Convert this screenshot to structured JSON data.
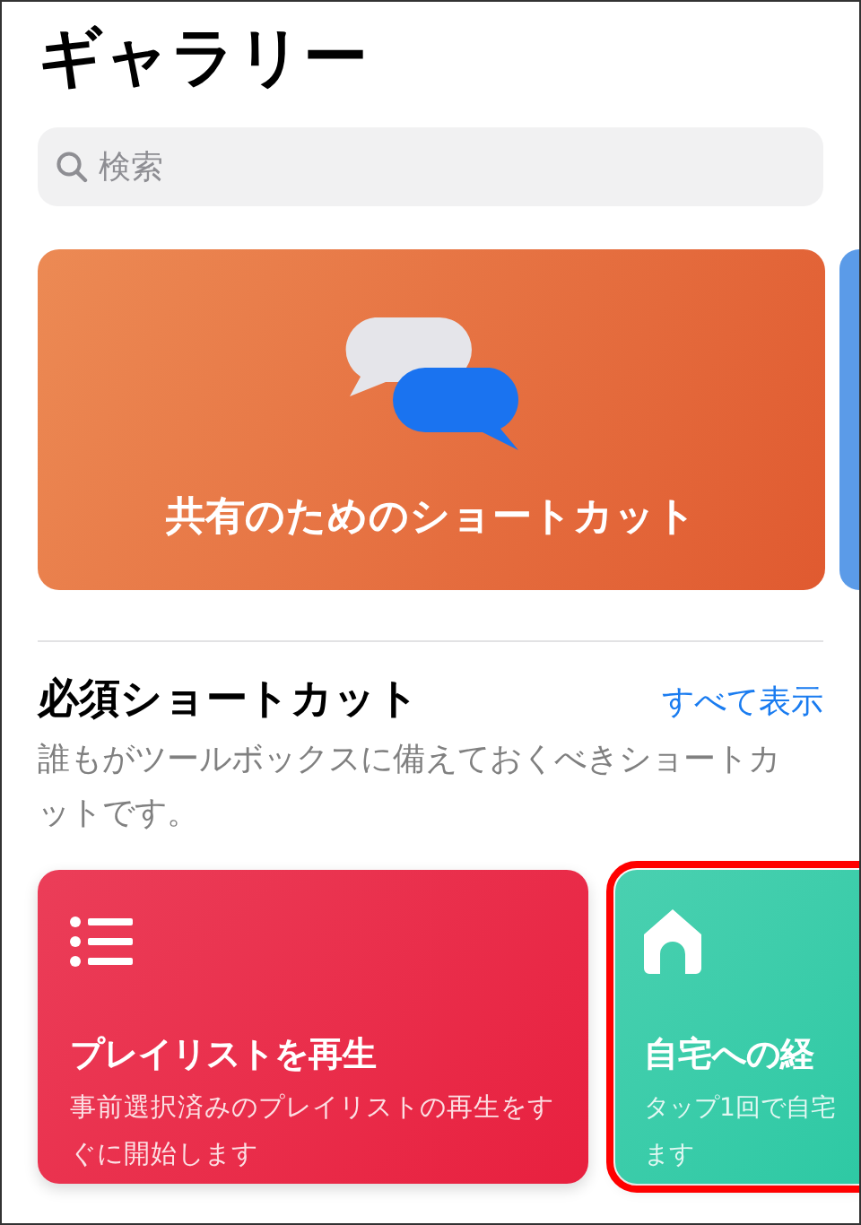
{
  "title": "ギャラリー",
  "search": {
    "placeholder": "検索"
  },
  "banner": {
    "title": "共有のためのショートカット"
  },
  "section": {
    "title": "必須ショートカット",
    "link": "すべて表示",
    "description": "誰もがツールボックスに備えておくべきショートカットです。"
  },
  "shortcuts": [
    {
      "kind": "list",
      "title": "プレイリストを再生",
      "description": "事前選択済みのプレイリストの再生をすぐに開始します",
      "color": "#e8203f",
      "highlighted": false
    },
    {
      "kind": "home",
      "title": "自宅への経",
      "description": "タップ1回で自宅ます",
      "color": "#2ec9a4",
      "highlighted": true
    }
  ]
}
